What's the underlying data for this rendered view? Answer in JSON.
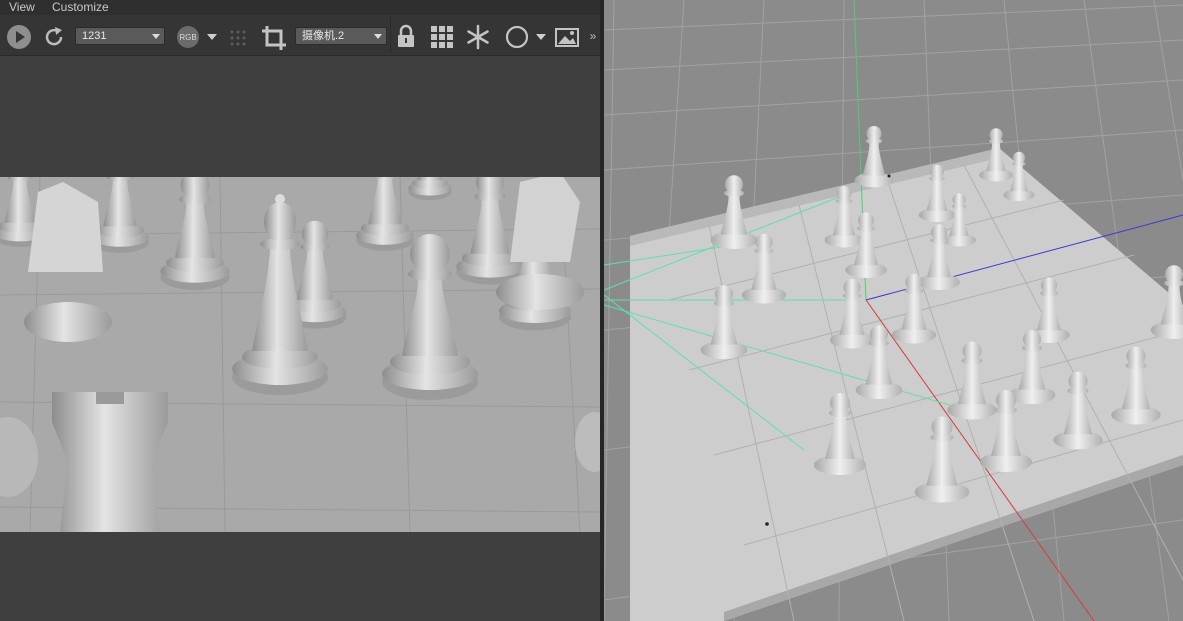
{
  "menu": {
    "view": "View",
    "customize": "Customize"
  },
  "toolbar": {
    "frame_value": "1231",
    "channel_label": "RGB",
    "camera_value": "摄像机.2",
    "overflow": "»"
  },
  "icons": {
    "play": "play-icon",
    "refresh": "refresh-icon",
    "channel": "rgb-channel-icon",
    "dots": "dot-grid-icon",
    "crop": "crop-icon",
    "lock": "lock-icon",
    "grid": "grid-icon",
    "snow": "snowflake-icon",
    "circle": "circle-icon",
    "image": "image-icon"
  },
  "colors": {
    "panel": "#3f3f3f",
    "toolbar": "#353535",
    "render_floor": "#a9a9a9",
    "viewport": "#8b8b8b",
    "board": "#c9c9c9",
    "axis_x": "#d63b3b",
    "axis_y": "#49d26a",
    "axis_z": "#3a3ad0",
    "camera_lines": "#5fe0a8"
  }
}
